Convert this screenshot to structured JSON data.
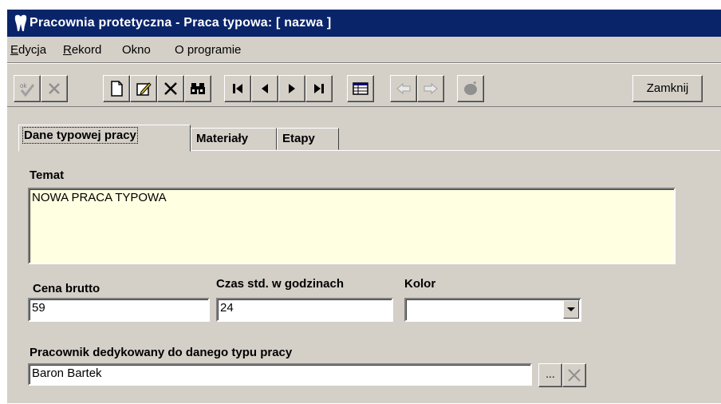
{
  "window": {
    "title": "Pracownia protetyczna - Praca typowa:  [ nazwa ]"
  },
  "menu": {
    "items": [
      {
        "underline": "E",
        "rest": "dycja"
      },
      {
        "underline": "R",
        "rest": "ekord"
      },
      {
        "underline": "",
        "rest": "Okno"
      },
      {
        "underline": "",
        "rest": "O programie"
      }
    ]
  },
  "toolbar": {
    "ok_label": "ok",
    "close_label": "Zamknij",
    "icons": [
      "ok-check-icon",
      "cancel-x-icon",
      "new-document-icon",
      "edit-icon",
      "delete-x-icon",
      "search-binoculars-icon",
      "first-record-icon",
      "previous-record-icon",
      "next-record-icon",
      "last-record-icon",
      "table-view-icon",
      "back-arrow-icon",
      "forward-arrow-icon",
      "filter-icon"
    ]
  },
  "tabs": [
    {
      "label": "Dane typowej pracy",
      "active": true
    },
    {
      "label": "Materiały",
      "active": false
    },
    {
      "label": "Etapy",
      "active": false
    }
  ],
  "form": {
    "temat_label": "Temat",
    "temat_value": "NOWA PRACA TYPOWA",
    "cena_label": "Cena brutto",
    "cena_value": "59",
    "czas_label": "Czas std. w godzinach",
    "czas_value": "24",
    "kolor_label": "Kolor",
    "kolor_value": "",
    "pracownik_label": "Pracownik dedykowany do danego typu pracy",
    "pracownik_value": "Baron Bartek",
    "browse_label": "..."
  },
  "colors": {
    "titlebar": "#0a246a",
    "face": "#d4d0c8",
    "memo_bg": "#ffffe1"
  }
}
